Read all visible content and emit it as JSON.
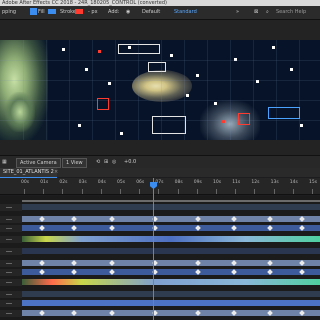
{
  "window": {
    "title": "Adobe After Effects CC 2018 - 24R_180205_CONTROL (converted)"
  },
  "toolbar": {
    "snapping_label": "pping",
    "fill_label": "Fill",
    "stroke_label": "Stroke",
    "stroke_width": "- px",
    "add_label": "Add:",
    "workspace_default": "Default",
    "workspace_standard": "Standard",
    "search_help_placeholder": "Search Help",
    "fill_color": "#3c8df0",
    "stroke_color": "#ff3b30"
  },
  "viewer": {
    "camera_label": "Active Camera",
    "view_label": "1 View",
    "exposure_value": "+0.0"
  },
  "timeline": {
    "comp_tab": "SITE_01_ATLANTIS 2",
    "tab_close": "×",
    "ruler_labels": [
      "00s",
      "01s",
      "02s",
      "03s",
      "04s",
      "05s",
      "06s",
      "07s",
      "08s",
      "09s",
      "10s",
      "11s",
      "12s",
      "13s",
      "14s",
      "15s"
    ]
  }
}
